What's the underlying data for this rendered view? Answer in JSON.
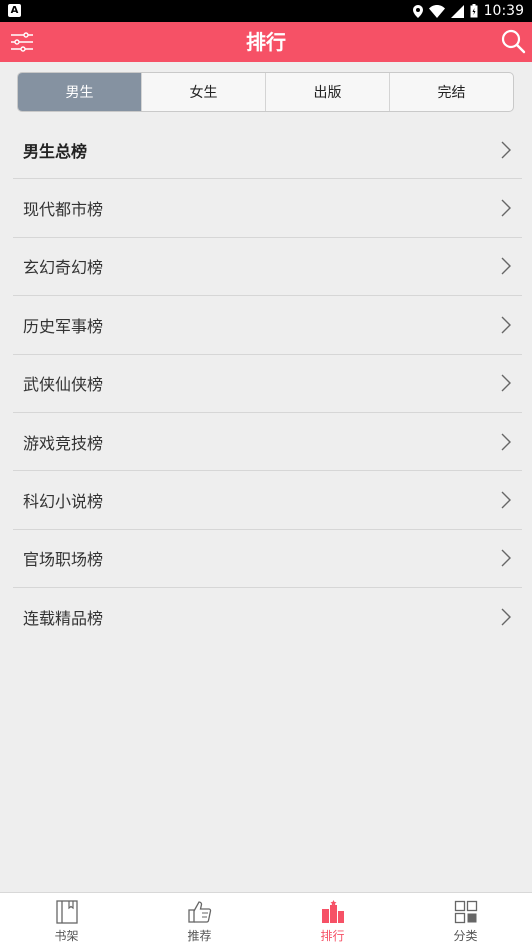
{
  "status_bar": {
    "time": "10:39"
  },
  "header": {
    "title": "排行"
  },
  "segments": [
    {
      "label": "男生",
      "active": true
    },
    {
      "label": "女生",
      "active": false
    },
    {
      "label": "出版",
      "active": false
    },
    {
      "label": "完结",
      "active": false
    }
  ],
  "ranking_list": [
    {
      "label": "男生总榜"
    },
    {
      "label": "现代都市榜"
    },
    {
      "label": "玄幻奇幻榜"
    },
    {
      "label": "历史军事榜"
    },
    {
      "label": "武侠仙侠榜"
    },
    {
      "label": "游戏竞技榜"
    },
    {
      "label": "科幻小说榜"
    },
    {
      "label": "官场职场榜"
    },
    {
      "label": "连载精品榜"
    }
  ],
  "bottom_tabs": [
    {
      "label": "书架",
      "icon": "bookshelf-icon",
      "active": false
    },
    {
      "label": "推荐",
      "icon": "thumbs-up-icon",
      "active": false
    },
    {
      "label": "排行",
      "icon": "ranking-icon",
      "active": true
    },
    {
      "label": "分类",
      "icon": "category-grid-icon",
      "active": false
    }
  ],
  "colors": {
    "accent": "#f65166",
    "segment_active": "#8592a1",
    "background": "#eeeeee"
  }
}
